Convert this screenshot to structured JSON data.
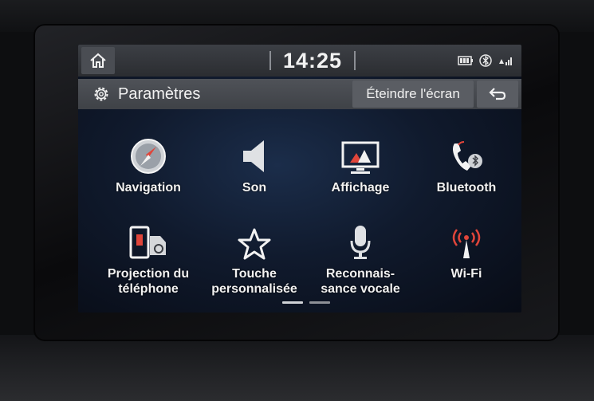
{
  "status_bar": {
    "time": "14:25"
  },
  "title_bar": {
    "title": "Paramètres",
    "screen_off_label": "Éteindre l'écran"
  },
  "menu": {
    "items": [
      {
        "label": "Navigation",
        "icon": "compass-icon"
      },
      {
        "label": "Son",
        "icon": "speaker-icon"
      },
      {
        "label": "Affichage",
        "icon": "display-icon"
      },
      {
        "label": "Bluetooth",
        "icon": "bluetooth-phone-icon"
      },
      {
        "label_line1": "Projection du",
        "label_line2": "téléphone",
        "icon": "phone-projection-icon"
      },
      {
        "label_line1": "Touche",
        "label_line2": "personnalisée",
        "icon": "star-icon"
      },
      {
        "label_line1": "Reconnais-",
        "label_line2": "sance vocale",
        "icon": "microphone-icon"
      },
      {
        "label": "Wi-Fi",
        "icon": "wifi-antenna-icon"
      }
    ]
  },
  "page_indicator": {
    "current": 1,
    "total": 2
  },
  "colors": {
    "accent_red": "#e0453a",
    "text": "#f2f2f2",
    "bar": "#3f4247"
  }
}
